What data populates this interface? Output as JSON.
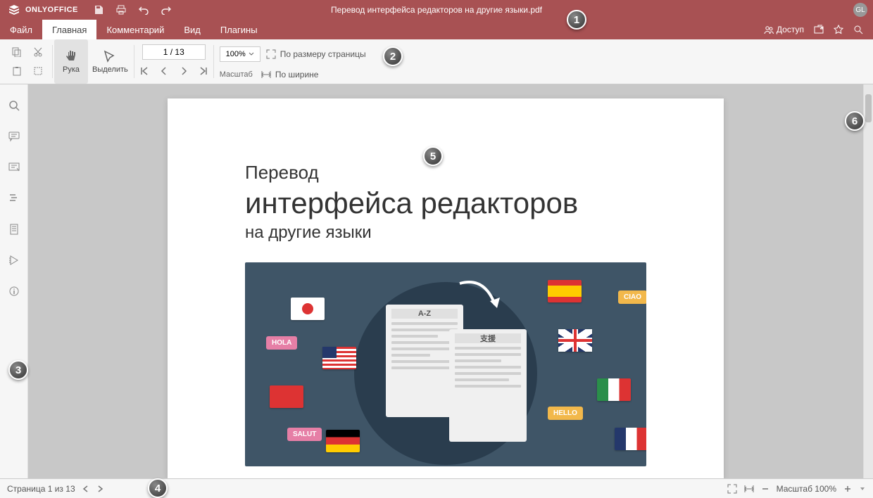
{
  "app": {
    "name": "ONLYOFFICE",
    "document_title": "Перевод интерфейса редакторов на другие языки.pdf",
    "user_initials": "GL"
  },
  "tabs": {
    "file": "Файл",
    "home": "Главная",
    "comment": "Комментарий",
    "view": "Вид",
    "plugins": "Плагины"
  },
  "header_right": {
    "share": "Доступ"
  },
  "toolbar": {
    "hand": "Рука",
    "select": "Выделить",
    "page_input": "1 / 13",
    "zoom_value": "100%",
    "zoom_label": "Масштаб",
    "fit_page": "По размеру страницы",
    "fit_width": "По ширине"
  },
  "document": {
    "line1": "Перевод",
    "line2": "интерфейса редакторов",
    "line3": "на другие языки",
    "sheet_az": "A-Z",
    "sheet_cjk": "支援",
    "bubble_hola": "HOLA",
    "bubble_salut": "SALUT",
    "bubble_ciao": "CIAO",
    "bubble_hello": "HELLO"
  },
  "statusbar": {
    "page_text": "Страница 1 из 13",
    "zoom_text": "Масштаб 100%"
  },
  "markers": {
    "m1": "1",
    "m2": "2",
    "m3": "3",
    "m4": "4",
    "m5": "5",
    "m6": "6"
  }
}
